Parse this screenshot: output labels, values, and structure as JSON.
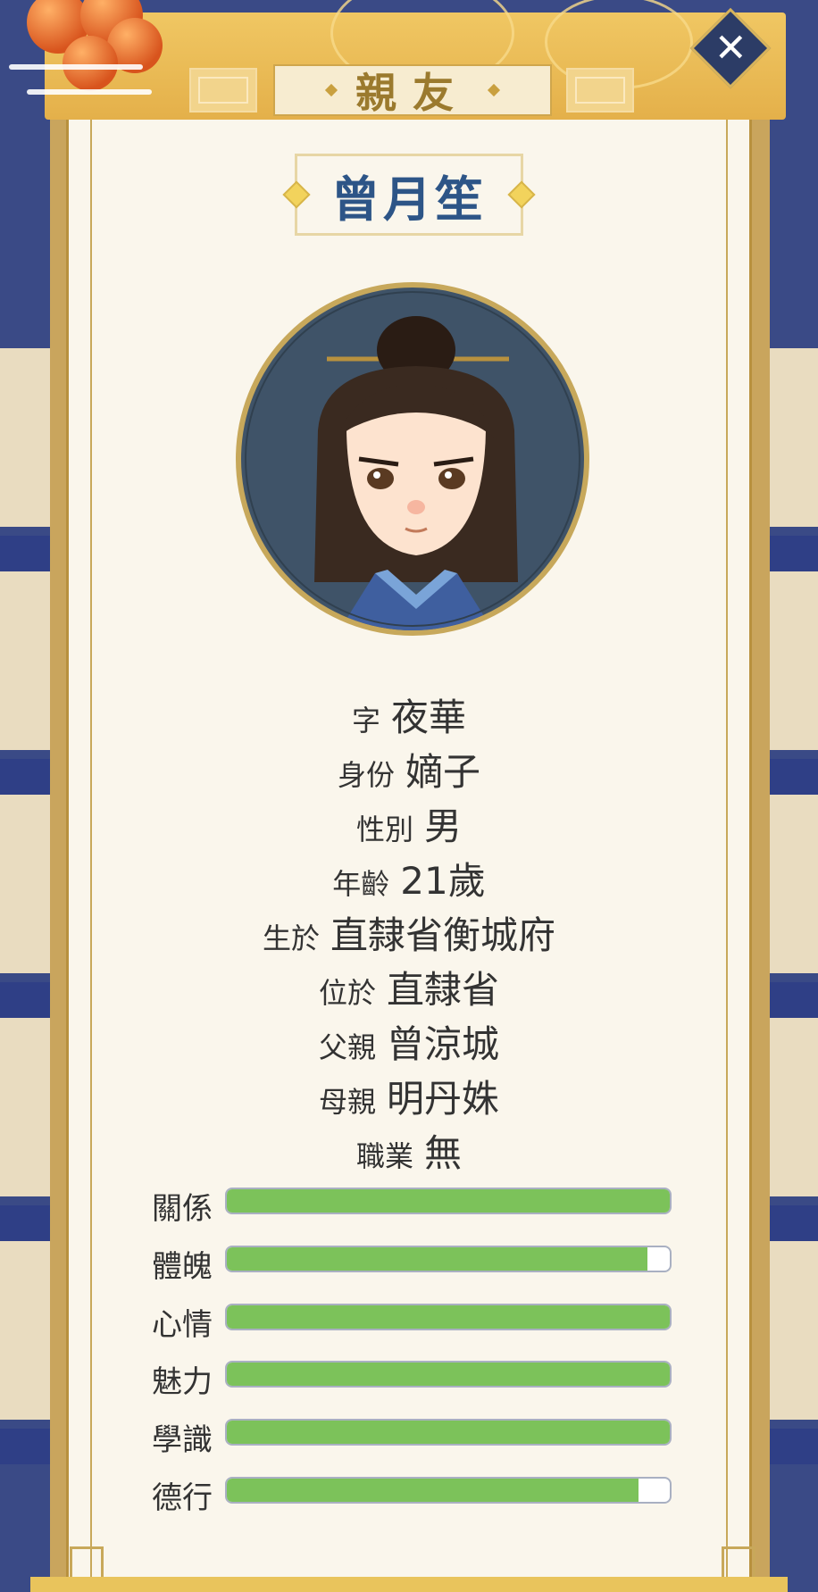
{
  "dialog": {
    "title": "親友",
    "close_icon": "close-icon"
  },
  "character": {
    "name": "曾月笙",
    "portrait_icon": "character-portrait"
  },
  "info": [
    {
      "label": "字",
      "value": "夜華"
    },
    {
      "label": "身份",
      "value": "嫡子"
    },
    {
      "label": "性別",
      "value": "男"
    },
    {
      "label": "年齡",
      "value": "21歲"
    },
    {
      "label": "生於",
      "value": "直隸省衡城府"
    },
    {
      "label": "位於",
      "value": "直隸省"
    },
    {
      "label": "父親",
      "value": "曾涼城"
    },
    {
      "label": "母親",
      "value": "明丹姝"
    },
    {
      "label": "職業",
      "value": "無"
    }
  ],
  "stats": [
    {
      "label": "關係",
      "level": 1.0
    },
    {
      "label": "體魄",
      "level": 0.95
    },
    {
      "label": "心情",
      "level": 1.0
    },
    {
      "label": "魅力",
      "level": 1.0
    },
    {
      "label": "學識",
      "level": 1.0
    },
    {
      "label": "德行",
      "level": 0.93
    }
  ],
  "colors": {
    "stat_fill": "#7cc25a",
    "name": "#2d5587",
    "frame_gold": "#c9a55d"
  }
}
